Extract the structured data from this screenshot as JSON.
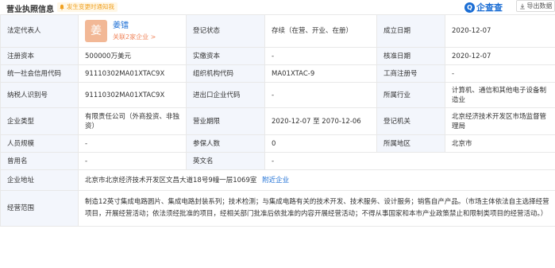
{
  "header": {
    "title": "营业执照信息",
    "notice": "发生变更时通知我",
    "brand": "企查查",
    "brand_logo_glyph": "Q",
    "export_label": "导出数据"
  },
  "row1": {
    "label_legal": "法定代表人",
    "avatar_char": "姜",
    "legal_name": "姜镭",
    "legal_related": "关联2家企业 >",
    "label_status": "登记状态",
    "status": "存续（在营、开业、在册）",
    "label_founded": "成立日期",
    "founded": "2020-12-07"
  },
  "row2": {
    "label_capital": "注册资本",
    "capital": "500000万美元",
    "label_paid": "实缴资本",
    "paid": "-",
    "label_approved": "核准日期",
    "approved": "2020-12-07"
  },
  "row3": {
    "label_credit": "统一社会信用代码",
    "credit": "91110302MA01XTAC9X",
    "label_org": "组织机构代码",
    "org": "MA01XTAC-9",
    "label_reg": "工商注册号",
    "reg": "-"
  },
  "row4": {
    "label_tax": "纳税人识别号",
    "tax": "91110302MA01XTAC9X",
    "label_import": "进出口企业代码",
    "import": "-",
    "label_industry": "所属行业",
    "industry": "计算机、通信和其他电子设备制造业"
  },
  "row5": {
    "label_type": "企业类型",
    "type": "有限责任公司（外商投资、非独资）",
    "label_term": "营业期限",
    "term": "2020-12-07 至 2070-12-06",
    "label_authority": "登记机关",
    "authority": "北京经济技术开发区市场监督管理局"
  },
  "row6": {
    "label_staff": "人员规模",
    "staff": "-",
    "label_insured": "参保人数",
    "insured": "0",
    "label_region": "所属地区",
    "region": "北京市"
  },
  "row7": {
    "label_former": "曾用名",
    "former": "-",
    "label_english": "英文名",
    "english": "-"
  },
  "row8": {
    "label_address": "企业地址",
    "address": "北京市北京经济技术开发区文昌大道18号9幢一层1069室",
    "nearby_link": "附近企业"
  },
  "row9": {
    "label_scope": "经营范围",
    "scope": "制造12英寸集成电路圆片、集成电路封装系列；技术检测；与集成电路有关的技术开发、技术服务、设计服务；销售自产产品。（市场主体依法自主选择经营项目，开展经营活动；依法须经批准的项目，经相关部门批准后依批准的内容开展经营活动；不得从事国家和本市产业政策禁止和限制类项目的经营活动。）"
  },
  "colors": {
    "label_bg": "#f3f6fc",
    "border": "#e8e8e8",
    "link": "#1a6dd4",
    "notice_text": "#f0a020",
    "avatar_bg": "#f2b896"
  }
}
